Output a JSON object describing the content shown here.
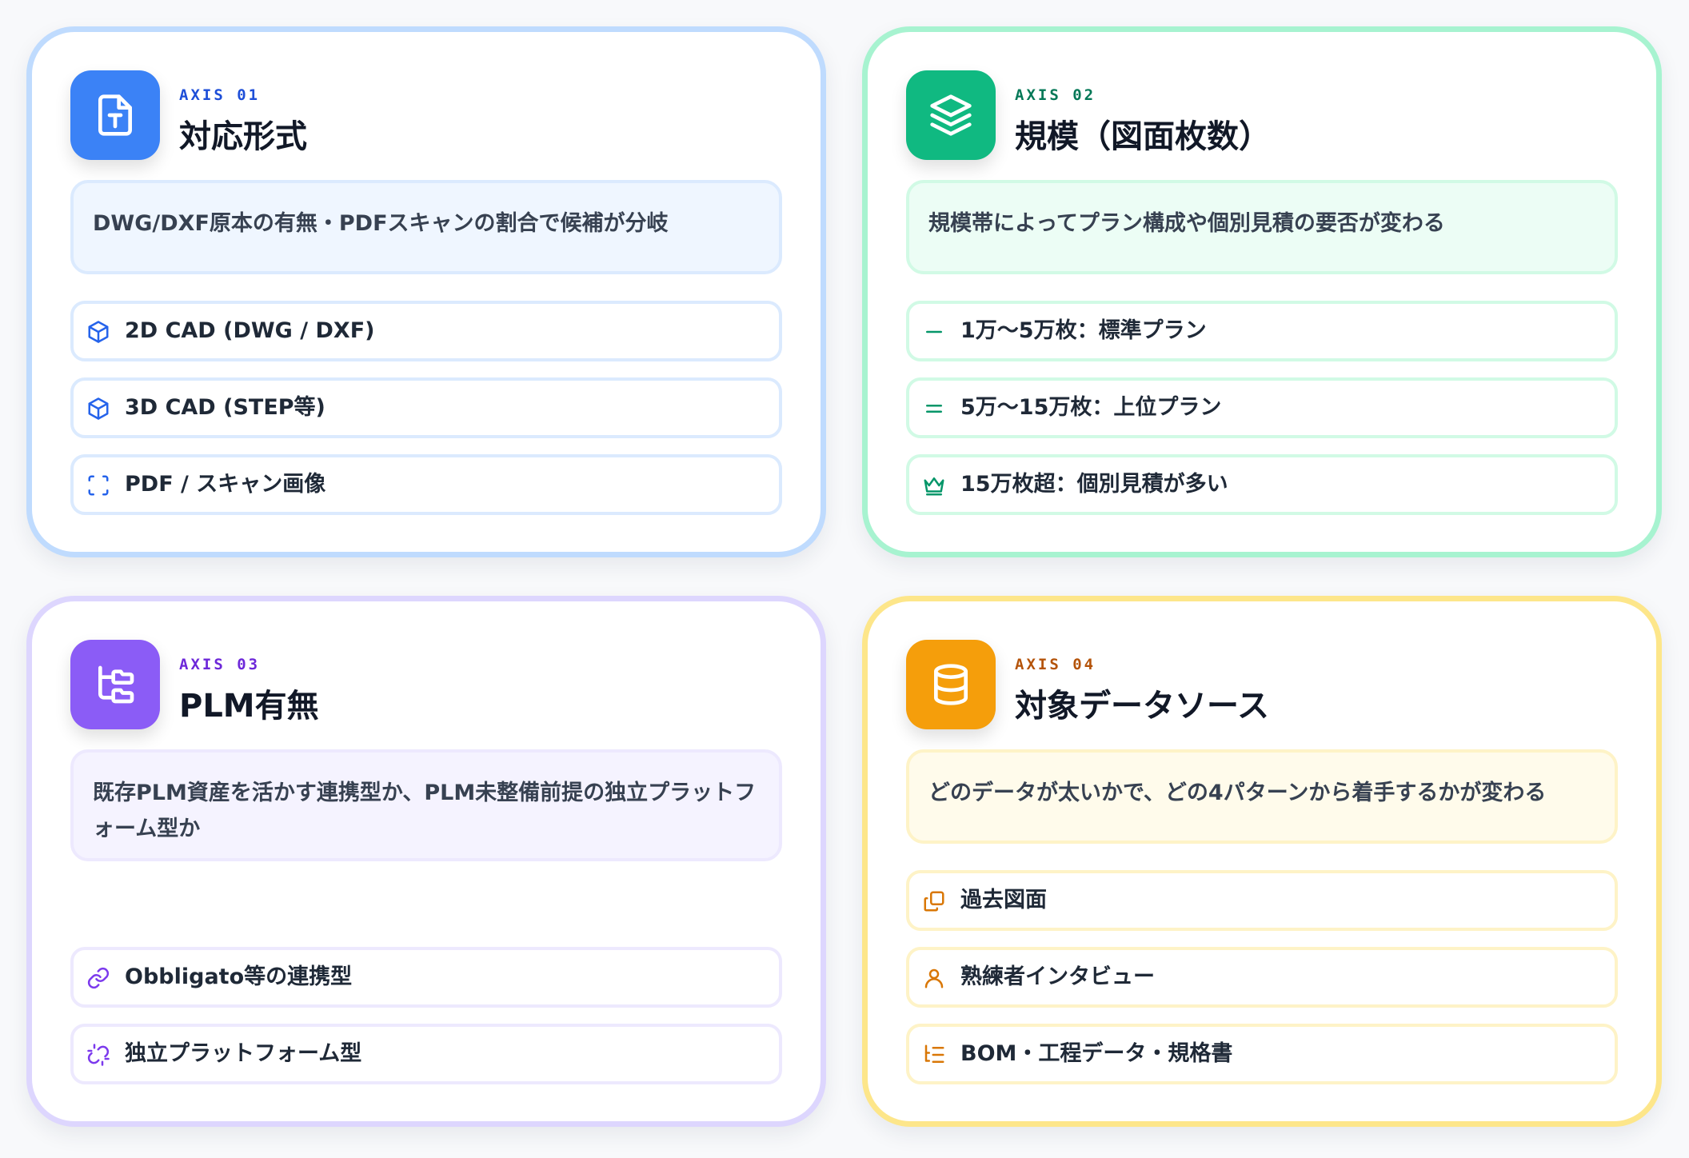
{
  "cards": [
    {
      "axis": "AXIS 01",
      "title": "対応形式",
      "description": "DWG/DXF原本の有無・PDFスキャンの割合で候補が分岐",
      "icon": "file-type-icon",
      "items": [
        {
          "label": "2D CAD (DWG / DXF)",
          "icon": "cube-icon"
        },
        {
          "label": "3D CAD (STEP等)",
          "icon": "cube-icon"
        },
        {
          "label": "PDF / スキャン画像",
          "icon": "scan-icon"
        }
      ]
    },
    {
      "axis": "AXIS 02",
      "title": "規模（図面枚数）",
      "description": "規模帯によってプラン構成や個別見積の要否が変わる",
      "icon": "layers-icon",
      "items": [
        {
          "label": "1万〜5万枚：標準プラン",
          "icon": "minus-icon"
        },
        {
          "label": "5万〜15万枚：上位プラン",
          "icon": "equals-icon"
        },
        {
          "label": "15万枚超：個別見積が多い",
          "icon": "crown-icon"
        }
      ]
    },
    {
      "axis": "AXIS 03",
      "title": "PLM有無",
      "description": "既存PLM資産を活かす連携型か、PLM未整備前提の独立プラットフォーム型か",
      "icon": "folder-tree-icon",
      "items": [
        {
          "label": "Obbligato等の連携型",
          "icon": "link-icon"
        },
        {
          "label": "独立プラットフォーム型",
          "icon": "unlink-icon"
        }
      ]
    },
    {
      "axis": "AXIS 04",
      "title": "対象データソース",
      "description": "どのデータが太いかで、どの4パターンから着手するかが変わる",
      "icon": "database-icon",
      "items": [
        {
          "label": "過去図面",
          "icon": "copy-icon"
        },
        {
          "label": "熟練者インタビュー",
          "icon": "user-icon"
        },
        {
          "label": "BOM・工程データ・規格書",
          "icon": "list-tree-icon"
        }
      ]
    }
  ]
}
